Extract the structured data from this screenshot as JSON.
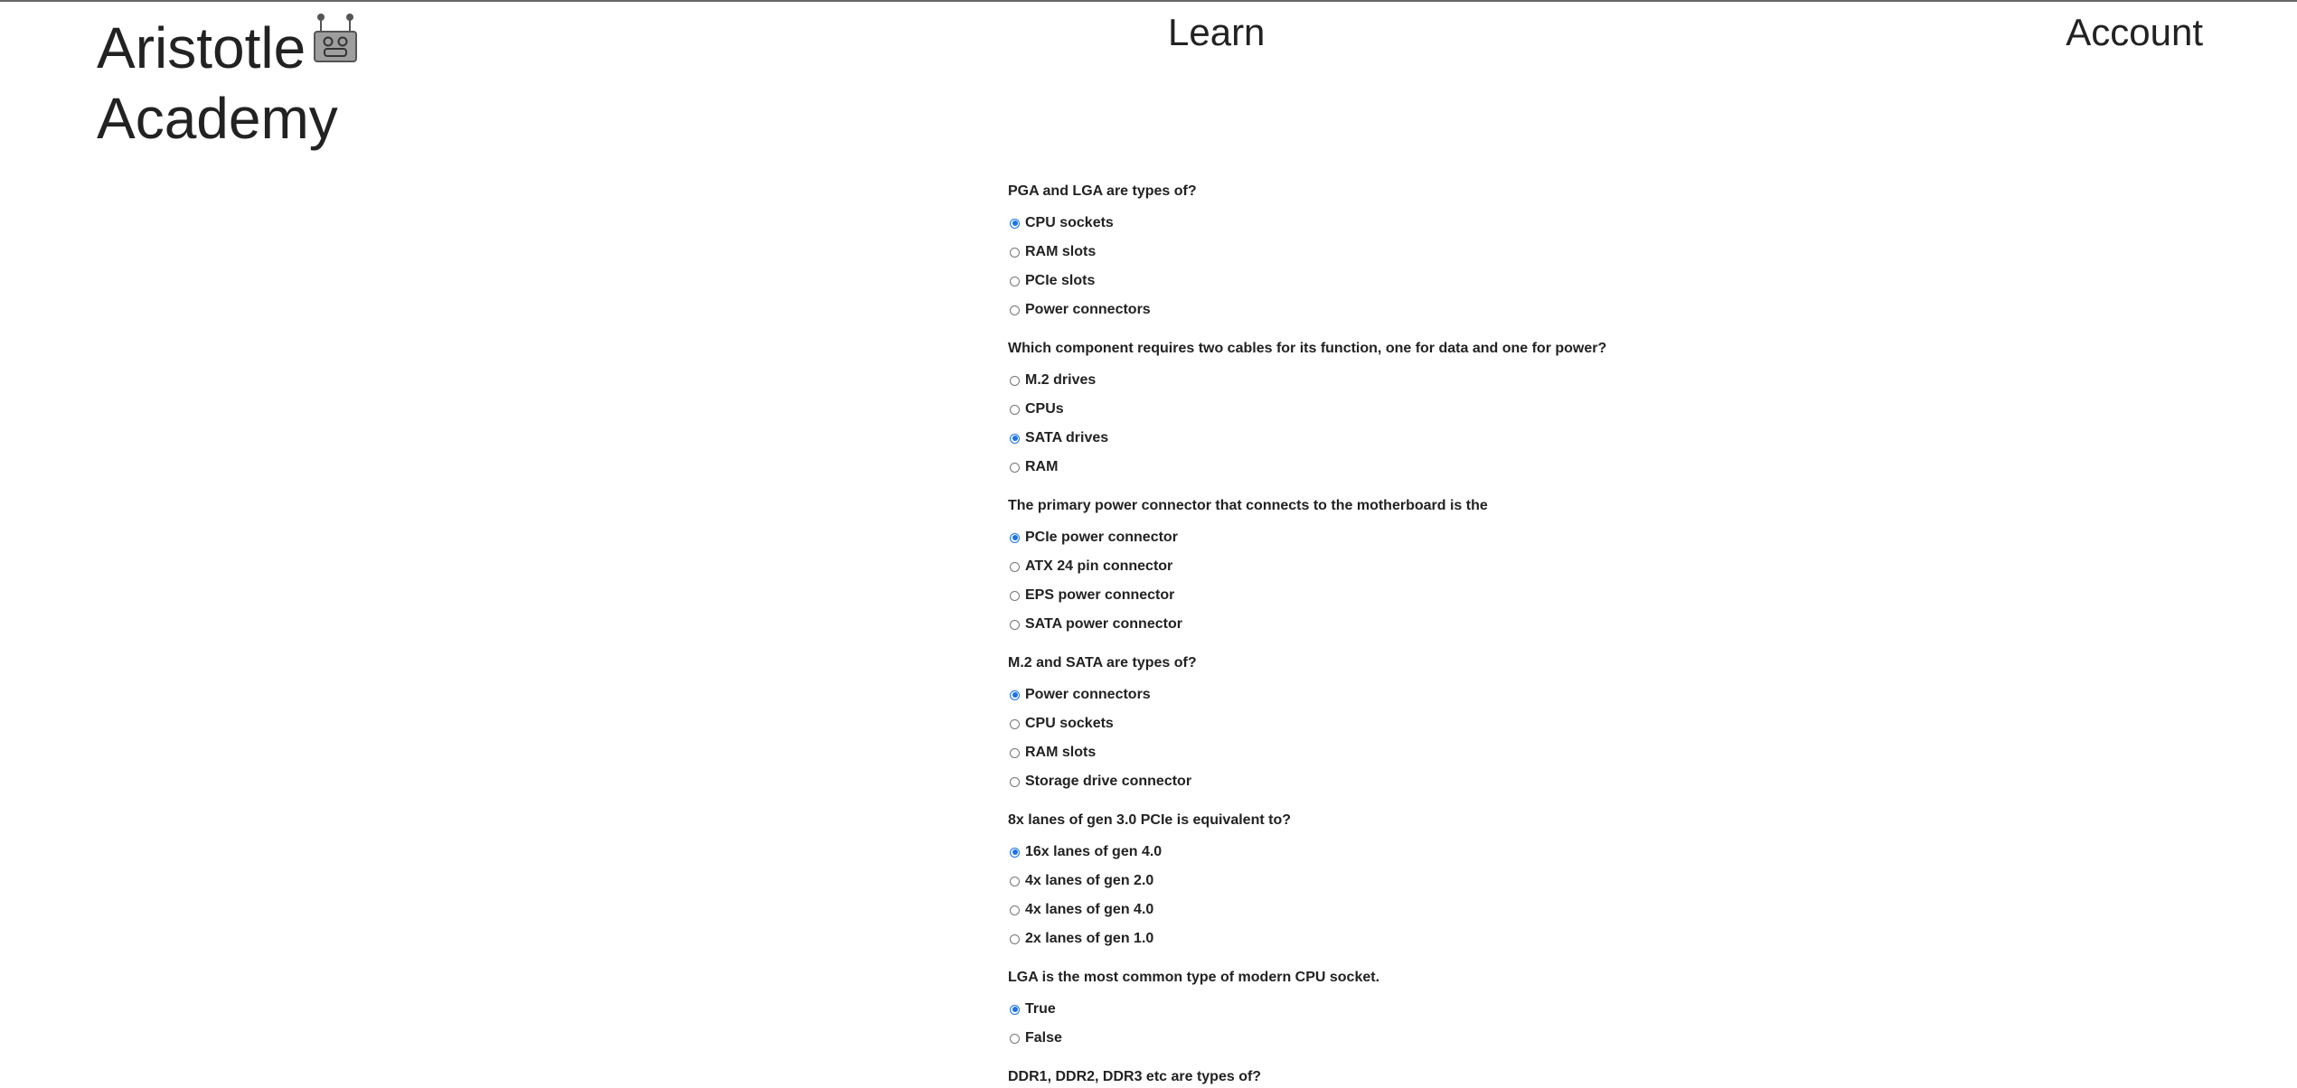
{
  "header": {
    "brand_line1": "Aristotle",
    "brand_line2": "Academy",
    "brand_icon": "robot-icon",
    "nav_learn": "Learn",
    "nav_account": "Account"
  },
  "colors": {
    "text": "#222222",
    "radio_checked": "#1a73e8",
    "radio_border": "#767676",
    "top_border": "#666666"
  },
  "questions": [
    {
      "text": "PGA and LGA are types of?",
      "options": [
        "CPU sockets",
        "RAM slots",
        "PCIe slots",
        "Power connectors"
      ],
      "selected": 0
    },
    {
      "text": "Which component requires two cables for its function, one for data and one for power?",
      "options": [
        "M.2 drives",
        "CPUs",
        "SATA drives",
        "RAM"
      ],
      "selected": 2
    },
    {
      "text": "The primary power connector that connects to the motherboard is the",
      "options": [
        "PCIe power connector",
        "ATX 24 pin connector",
        "EPS power connector",
        "SATA power connector"
      ],
      "selected": 0
    },
    {
      "text": "M.2 and SATA are types of?",
      "options": [
        "Power connectors",
        "CPU sockets",
        "RAM slots",
        "Storage drive connector"
      ],
      "selected": 0
    },
    {
      "text": "8x lanes of gen 3.0 PCIe is equivalent to?",
      "options": [
        "16x lanes of gen 4.0",
        "4x lanes of gen 2.0",
        "4x lanes of gen 4.0",
        "2x lanes of gen 1.0"
      ],
      "selected": 0
    },
    {
      "text": "LGA is the most common type of modern CPU socket.",
      "options": [
        "True",
        "False"
      ],
      "selected": 0
    },
    {
      "text": "DDR1, DDR2, DDR3 etc are types of?",
      "options": [],
      "selected": null
    }
  ]
}
